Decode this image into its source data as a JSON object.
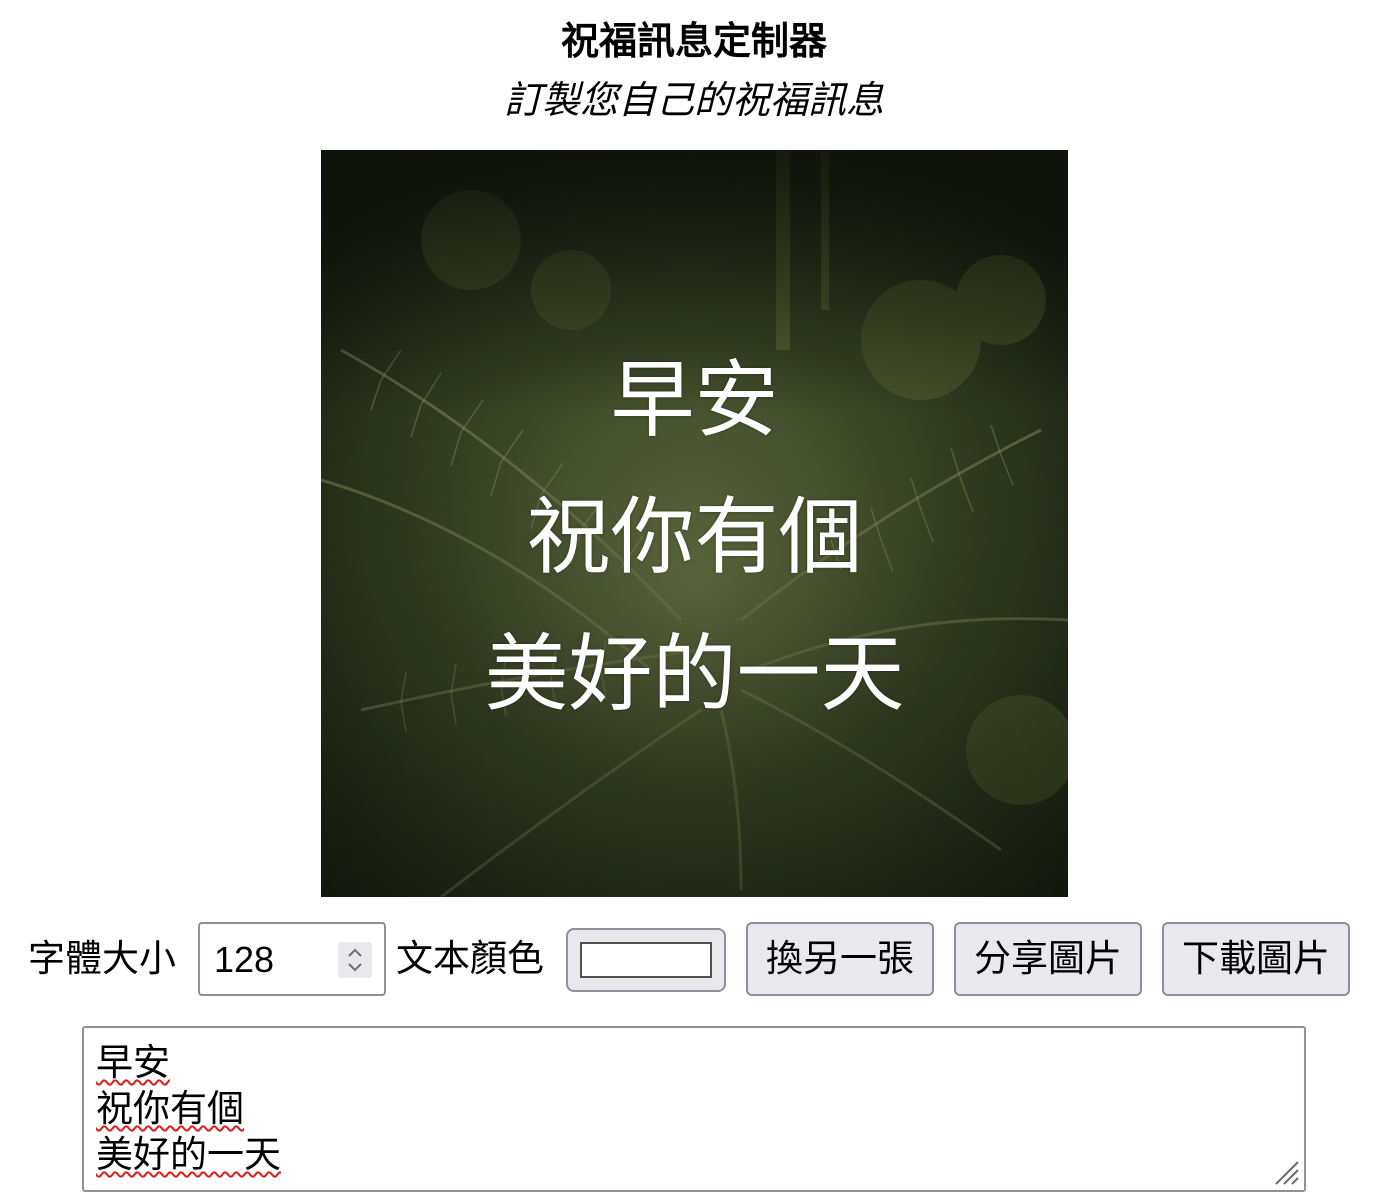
{
  "header": {
    "title": "祝福訊息定制器",
    "subtitle": "訂製您自己的祝福訊息"
  },
  "preview": {
    "lines": [
      "早安",
      "祝你有個",
      "美好的一天"
    ],
    "text_color": "#ffffff"
  },
  "controls": {
    "font_size_label": "字體大小",
    "font_size_value": "128",
    "text_color_label": "文本顏色",
    "text_color_value": "#ffffff",
    "change_button": "換另一張",
    "share_button": "分享圖片",
    "download_button": "下載圖片"
  },
  "message": {
    "lines": [
      "早安",
      "祝你有個",
      "美好的一天"
    ]
  },
  "icons": {
    "spinner": "up-down-chevron-icon",
    "resize": "resize-grip-icon"
  }
}
